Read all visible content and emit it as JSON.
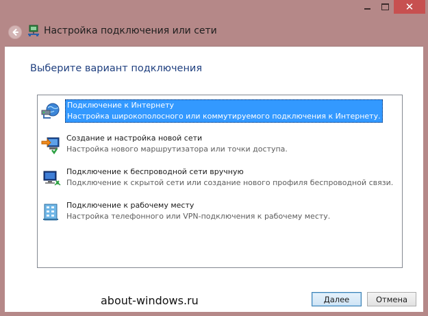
{
  "window": {
    "title": "Настройка подключения или сети",
    "close_glyph": "✕"
  },
  "heading": "Выберите вариант подключения",
  "options": [
    {
      "title": "Подключение к Интернету",
      "description": "Настройка широкополосного или коммутируемого подключения к Интернету.",
      "icon": "globe-network-icon",
      "selected": true
    },
    {
      "title": "Создание и настройка новой сети",
      "description": "Настройка нового маршрутизатора или точки доступа.",
      "icon": "router-setup-icon",
      "selected": false
    },
    {
      "title": "Подключение к беспроводной сети вручную",
      "description": "Подключение к скрытой сети или создание нового профиля беспроводной связи.",
      "icon": "wireless-computer-icon",
      "selected": false
    },
    {
      "title": "Подключение к рабочему месту",
      "description": "Настройка телефонного или VPN-подключения к рабочему месту.",
      "icon": "workplace-building-icon",
      "selected": false
    }
  ],
  "watermark": "about-windows.ru",
  "buttons": {
    "next": "Далее",
    "cancel": "Отмена"
  },
  "colors": {
    "accent_selection": "#3399ff",
    "heading_blue": "#1f3f7f",
    "frame": "#b58888",
    "close_red": "#c75050"
  }
}
